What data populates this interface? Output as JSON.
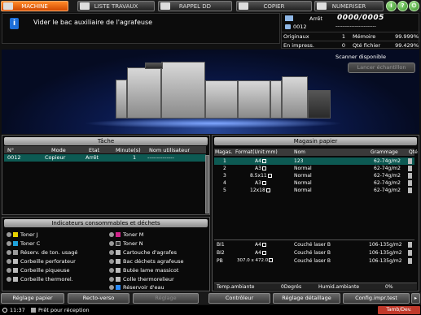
{
  "tabs": {
    "machine": "MACHINE",
    "liste_travaux": "LISTE TRAVAUX",
    "rappel_dd": "RAPPEL DD",
    "copier": "COPIER",
    "numeriser": "NUMERISER"
  },
  "right_buttons": {
    "info": "i",
    "help": "?",
    "power": "⏻"
  },
  "message": {
    "icon": "i",
    "text": "Vider le bac auxiliaire de l'agrafeuse"
  },
  "counter": {
    "status": "Arrêt",
    "count": "0000/0005",
    "job_no": "0012",
    "dashes": "-----------------------",
    "originaux_label": "Originaux",
    "originaux_value": "1",
    "memoire_label": "Mémoire",
    "memoire_value": "99.999%",
    "impress_label": "En impress.",
    "impress_value": "0",
    "qte_fichier_label": "Qté fichier",
    "qte_fichier_value": "99.429%"
  },
  "banner": {
    "scanner_status": "Scanner disponible",
    "sample_button": "Lancer échantillon"
  },
  "tache": {
    "title": "Tâche",
    "headers": [
      "N°",
      "Mode",
      "Etat",
      "Minute(s)",
      "Nom utilisateur"
    ],
    "row": [
      "0012",
      "Copieur",
      "Arrêt",
      "1",
      "--------------"
    ]
  },
  "consumables": {
    "title": "Indicateurs consommables et déchets",
    "left": [
      "Toner J",
      "Toner C",
      "Réserv. de ton. usagé",
      "Corbeille perforateur",
      "Corbeille piqueuse",
      "Corbeille thermorel."
    ],
    "right": [
      "Toner M",
      "Toner N",
      "Cartouche d'agrafes",
      "Bac déchets agrafeuse",
      "Butée lame massicot",
      "Colle thermorelieur",
      "Réservoir d'eau"
    ]
  },
  "magasin": {
    "title": "Magasin papier",
    "headers": [
      "Magas.",
      "Format(Unit:mm)",
      "Nom",
      "Grammage",
      "Qté"
    ],
    "rows": [
      [
        "1",
        "A4",
        "123",
        "62-74g/m2"
      ],
      [
        "2",
        "A3",
        "Normal",
        "62-74g/m2"
      ],
      [
        "3",
        "8.5x11",
        "Normal",
        "62-74g/m2"
      ],
      [
        "4",
        "A3",
        "Normal",
        "62-74g/m2"
      ],
      [
        "5",
        "12x18",
        "Normal",
        "62-74g/m2"
      ]
    ],
    "bypass_rows": [
      [
        "BI1",
        "A4",
        "Couché laser B",
        "106-135g/m2"
      ],
      [
        "BI2",
        "A4",
        "Couché laser B",
        "106-135g/m2"
      ],
      [
        "PB",
        "307.0 x 472.0",
        "Couché laser B",
        "106-135g/m2"
      ]
    ],
    "temp_label": "Temp.ambiante",
    "temp_value": "0Degrés",
    "humid_label": "Humid.ambiante",
    "humid_value": "0%"
  },
  "bottom_buttons": {
    "reglage_papier": "Réglage papier",
    "recto_verso": "Recto-verso",
    "reglage": "Réglage",
    "controleur": "Contrôleur",
    "reglage_detaillage": "Réglage détaillage",
    "config_impr_test": "Config.impr.test"
  },
  "status_bar": {
    "time": "11:37",
    "status": "Prêt pour réception",
    "tamb": "Tamb/Dev."
  }
}
